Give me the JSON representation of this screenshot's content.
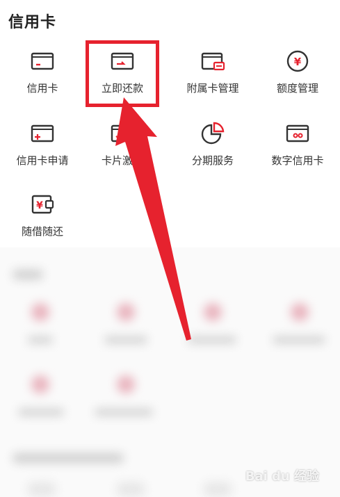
{
  "section": {
    "title": "信用卡"
  },
  "items": [
    {
      "label": "信用卡",
      "icon": "credit-card-icon"
    },
    {
      "label": "立即还款",
      "icon": "repay-card-icon"
    },
    {
      "label": "附属卡管理",
      "icon": "supplementary-card-icon"
    },
    {
      "label": "额度管理",
      "icon": "yen-circle-icon"
    },
    {
      "label": "信用卡申请",
      "icon": "card-apply-icon"
    },
    {
      "label": "卡片激活",
      "icon": "card-activate-icon"
    },
    {
      "label": "分期服务",
      "icon": "pie-chart-icon"
    },
    {
      "label": "数字信用卡",
      "icon": "digital-card-icon"
    },
    {
      "label": "随借随还",
      "icon": "yen-wallet-icon"
    }
  ],
  "colors": {
    "icon_dark": "#333333",
    "accent": "#e6222e",
    "annotation": "#e6222e"
  },
  "watermark": {
    "text": "Bai du 经验"
  }
}
